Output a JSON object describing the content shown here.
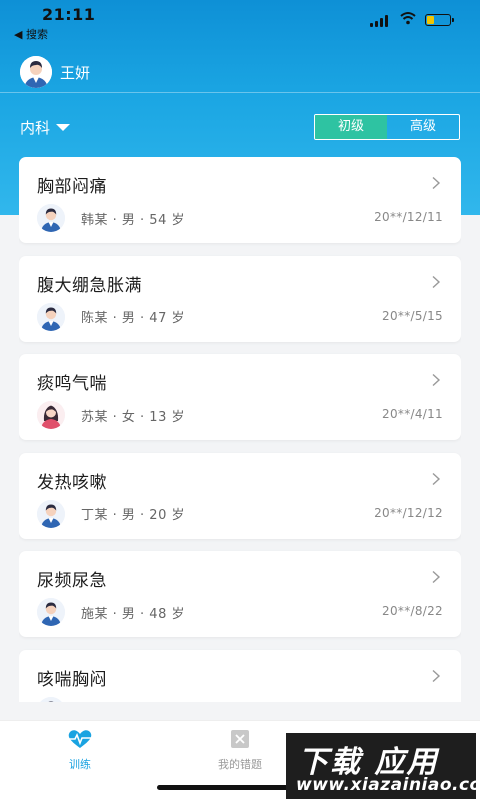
{
  "status_bar": {
    "time": "21:11",
    "back_label": "◀ 搜索"
  },
  "user": {
    "name": "王妍"
  },
  "filter": {
    "department": "内科",
    "levels": [
      {
        "label": "初级",
        "active": true
      },
      {
        "label": "高级",
        "active": false
      }
    ]
  },
  "cases": [
    {
      "title": "胸部闷痛",
      "patient": "韩某 · 男 · 54 岁",
      "gender": "male",
      "date": "20**/12/11"
    },
    {
      "title": "腹大绷急胀满",
      "patient": "陈某 · 男 · 47 岁",
      "gender": "male",
      "date": "20**/5/15"
    },
    {
      "title": "痰鸣气喘",
      "patient": "苏某 · 女 · 13 岁",
      "gender": "female",
      "date": "20**/4/11"
    },
    {
      "title": "发热咳嗽",
      "patient": "丁某 · 男 · 20 岁",
      "gender": "male",
      "date": "20**/12/12"
    },
    {
      "title": "尿频尿急",
      "patient": "施某 · 男 · 48 岁",
      "gender": "male",
      "date": "20**/8/22"
    },
    {
      "title": "咳喘胸闷",
      "patient": "",
      "gender": "male",
      "date": ""
    }
  ],
  "tabs": [
    {
      "label": "训练",
      "icon": "heartbeat-icon",
      "active": true
    },
    {
      "label": "我的错题",
      "icon": "wrong-questions-icon",
      "active": false
    }
  ],
  "watermark": {
    "big": "下载 应用",
    "small": "www.xiazainiao.com"
  },
  "colors": {
    "accent": "#1aa3e1",
    "active_level": "#2ec3a2",
    "header_top": "#0e90d6"
  }
}
